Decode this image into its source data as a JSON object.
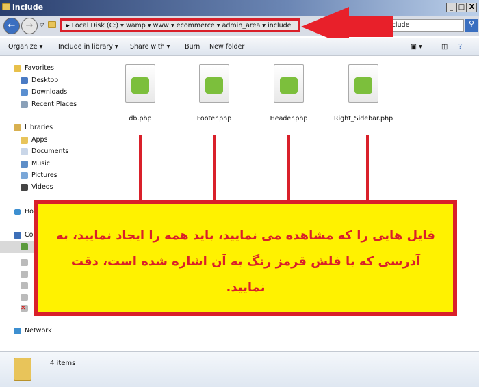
{
  "window": {
    "title": "include"
  },
  "address": {
    "segments": [
      "Local Disk (C:)",
      "wamp",
      "www",
      "ecommerce",
      "admin_area",
      "include"
    ]
  },
  "search": {
    "value": "include"
  },
  "toolbar": {
    "organize": "Organize",
    "include_library": "Include in library",
    "share_with": "Share with",
    "burn": "Burn",
    "new_folder": "New folder"
  },
  "sidebar": {
    "favorites": "Favorites",
    "fav_items": [
      "Desktop",
      "Downloads",
      "Recent Places"
    ],
    "libraries": "Libraries",
    "lib_items": [
      "Apps",
      "Documents",
      "Music",
      "Pictures",
      "Videos"
    ],
    "homegroup": "Ho",
    "computer": "Co",
    "network": "Network"
  },
  "files": [
    "db.php",
    "Footer.php",
    "Header.php",
    "Right_Sidebar.php"
  ],
  "status": {
    "count": "4 items"
  },
  "note": {
    "line1": "فایل هایی را که مشاهده می نمایید، باید همه را ایجاد نمایید، به",
    "line2": "آدرسی که با فلش قرمز رنگ به آن اشاره شده است، دقت نمایید."
  },
  "colors": {
    "annotation_red": "#d9202a",
    "note_bg": "#fff200"
  }
}
